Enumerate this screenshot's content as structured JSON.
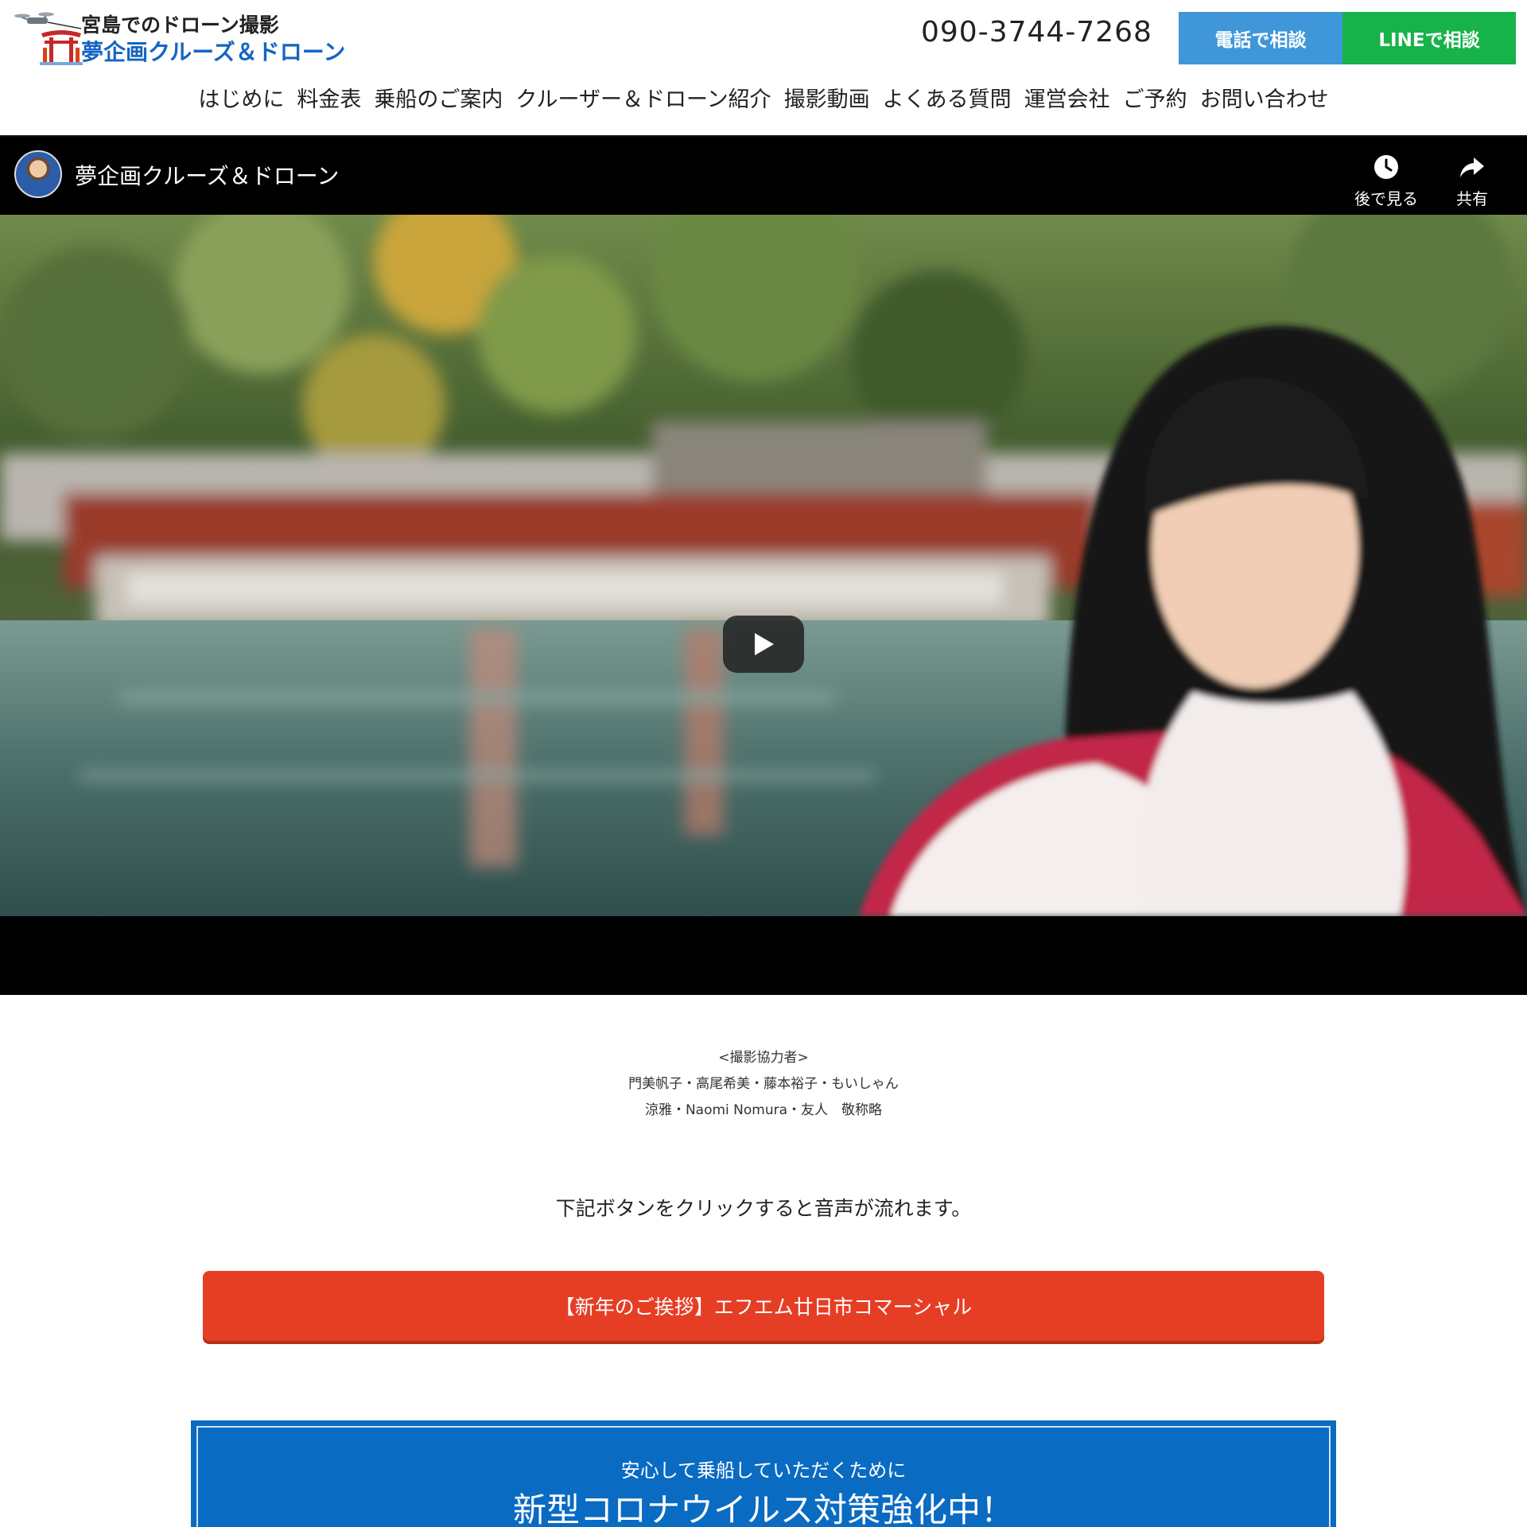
{
  "header": {
    "logo_line1": "宮島でのドローン撮影",
    "logo_line2": "夢企画クルーズ＆ドローン",
    "phone": "090-3744-7268",
    "btn_phone": "電話で相談",
    "btn_line": "LINEで相談",
    "colors": {
      "btn_phone": "#3f97d9",
      "btn_line": "#17b24a",
      "logo_blue": "#1565c0"
    }
  },
  "nav": {
    "items": [
      {
        "label": "はじめに"
      },
      {
        "label": "料金表"
      },
      {
        "label": "乗船のご案内"
      },
      {
        "label": "クルーザー＆ドローン紹介"
      },
      {
        "label": "撮影動画"
      },
      {
        "label": "よくある質問"
      },
      {
        "label": "運営会社"
      },
      {
        "label": "ご予約"
      },
      {
        "label": "お問い合わせ"
      }
    ]
  },
  "video": {
    "channel_title": "夢企画クルーズ＆ドローン",
    "watch_later": "後で見る",
    "share": "共有",
    "icons": {
      "watch_later": "clock-icon",
      "share": "share-arrow-icon",
      "play": "play-icon"
    }
  },
  "credits": {
    "heading": "<撮影協力者>",
    "line1": "門美帆子・高尾希美・藤本裕子・もいしゃん",
    "line2": "涼雅・Naomi Nomura・友人　敬称略"
  },
  "notice": "下記ボタンをクリックすると音声が流れます。",
  "cm_button": {
    "label": "【新年のご挨拶】エフエム廿日市コマーシャル",
    "color": "#e63e24"
  },
  "covid": {
    "sub": "安心して乗船していただくために",
    "title": "新型コロナウイルス対策強化中！",
    "color": "#0a6bc2"
  }
}
